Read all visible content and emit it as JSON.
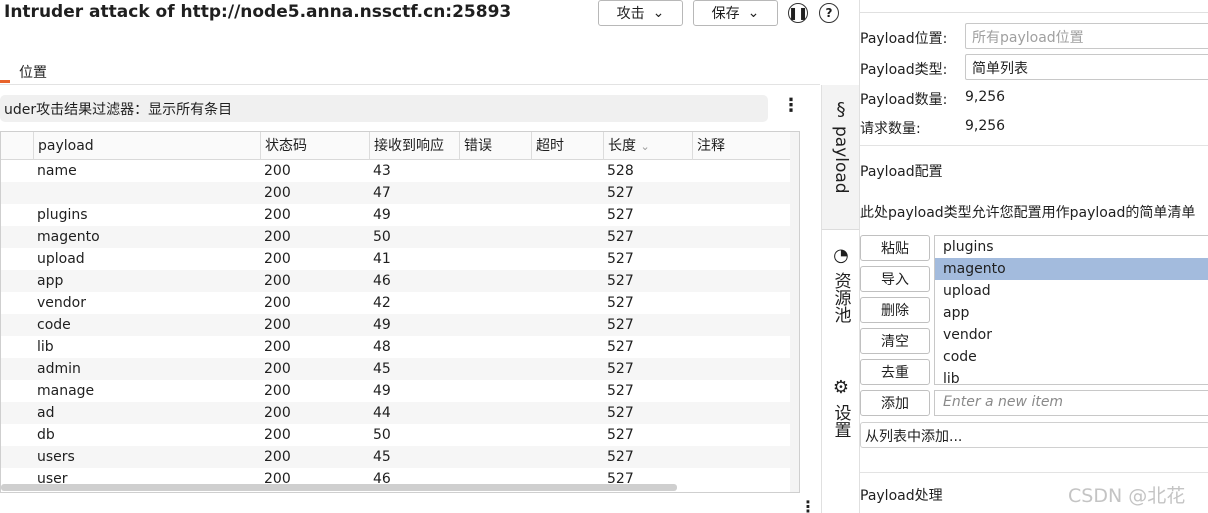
{
  "window": {
    "title": "Intruder attack of http://node5.anna.nssctf.cn:25893",
    "attack_label": "攻击",
    "save_label": "保存",
    "pause_icon": "pause-icon",
    "help_icon": "help-icon"
  },
  "tabs": {
    "position": "位置"
  },
  "filter": {
    "text": "uder攻击结果过滤器：显示所有条目"
  },
  "results_table": {
    "columns": [
      "payload",
      "状态码",
      "接收到响应",
      "错误",
      "超时",
      "长度",
      "注释"
    ],
    "sort_column": "长度",
    "rows": [
      {
        "payload": "name",
        "status": "200",
        "received": "43",
        "length": "528"
      },
      {
        "payload": "",
        "status": "200",
        "received": "47",
        "length": "527"
      },
      {
        "payload": "plugins",
        "status": "200",
        "received": "49",
        "length": "527"
      },
      {
        "payload": "magento",
        "status": "200",
        "received": "50",
        "length": "527"
      },
      {
        "payload": "upload",
        "status": "200",
        "received": "41",
        "length": "527"
      },
      {
        "payload": "app",
        "status": "200",
        "received": "46",
        "length": "527"
      },
      {
        "payload": "vendor",
        "status": "200",
        "received": "42",
        "length": "527"
      },
      {
        "payload": "code",
        "status": "200",
        "received": "49",
        "length": "527"
      },
      {
        "payload": "lib",
        "status": "200",
        "received": "48",
        "length": "527"
      },
      {
        "payload": "admin",
        "status": "200",
        "received": "45",
        "length": "527"
      },
      {
        "payload": "manage",
        "status": "200",
        "received": "49",
        "length": "527"
      },
      {
        "payload": "ad",
        "status": "200",
        "received": "44",
        "length": "527"
      },
      {
        "payload": "db",
        "status": "200",
        "received": "50",
        "length": "527"
      },
      {
        "payload": "users",
        "status": "200",
        "received": "45",
        "length": "527"
      },
      {
        "payload": "user",
        "status": "200",
        "received": "46",
        "length": "527"
      }
    ]
  },
  "side_tabs": {
    "payload": "payload",
    "resource_pool": "资源池",
    "settings": "设置"
  },
  "payload_panel": {
    "position_label": "Payload位置:",
    "position_placeholder": "所有payload位置",
    "type_label": "Payload类型:",
    "type_value": "简单列表",
    "count_label": "Payload数量:",
    "count_value": "9,256",
    "requests_label": "请求数量:",
    "requests_value": "9,256",
    "config_title": "Payload配置",
    "config_desc": "此处payload类型允许您配置用作payload的简单清单",
    "buttons": {
      "paste": "粘贴",
      "import": "导入",
      "delete": "删除",
      "clear": "清空",
      "dedupe": "去重",
      "add": "添加"
    },
    "list_items": [
      "plugins",
      "magento",
      "upload",
      "app",
      "vendor",
      "code",
      "lib"
    ],
    "selected_item": "magento",
    "add_placeholder": "Enter a new item",
    "add_from_list": "从列表中添加...",
    "processing_title": "Payload处理"
  },
  "watermark": "CSDN @北花"
}
